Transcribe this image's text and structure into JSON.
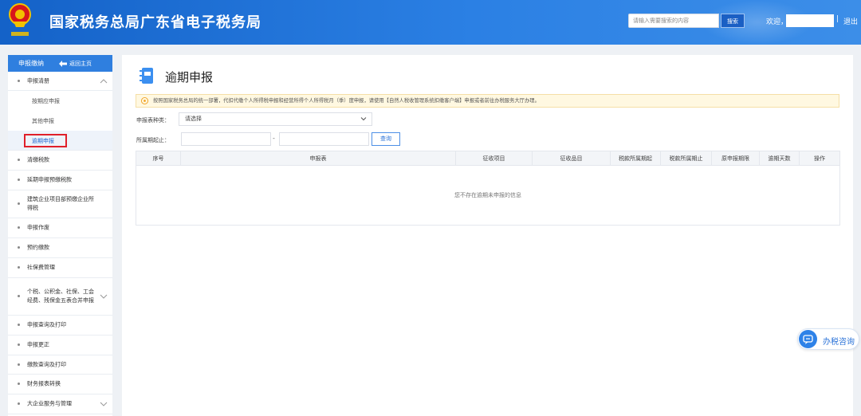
{
  "header": {
    "site_title": "国家税务总局广东省电子税务局",
    "search_placeholder": "请输入需要搜索的内容",
    "search_button": "搜索",
    "welcome": "欢迎，",
    "separator": "|",
    "logout": "退出",
    "colors": {
      "bar": "#1f6fd6"
    }
  },
  "sidebar": {
    "title": "申报缴纳",
    "home_link": "返回主页",
    "items": [
      {
        "label": "申报清册",
        "expanded": true,
        "sub": [
          {
            "label": "按期应申报"
          },
          {
            "label": "其他申报"
          },
          {
            "label": "逾期申报",
            "active": true
          }
        ]
      },
      {
        "label": "清缴税款"
      },
      {
        "label": "延期申报预缴税款"
      },
      {
        "label": "建筑企业项目部预缴企业所得税"
      },
      {
        "label": "申报作废"
      },
      {
        "label": "预约缴款"
      },
      {
        "label": "社保费管理"
      },
      {
        "label": "个税、公积金、社保、工会经费、残保金五表合并申报"
      },
      {
        "label": "申报查询及打印"
      },
      {
        "label": "申报更正"
      },
      {
        "label": "缴款查询及打印"
      },
      {
        "label": "财务报表转换"
      },
      {
        "label": "大企业服务与管理"
      }
    ]
  },
  "main": {
    "title": "逾期申报",
    "notice": "按照国家税务总局的统一部署，代扣代缴个人所得税申报和经营所得个人所得税月（季）度申报，请使用【自然人税收管理系统扣缴客户端】申报或者前往办税服务大厅办理。",
    "form": {
      "type_label": "申报表种类：",
      "type_value": "请选择",
      "period_label": "所属期起止：",
      "dash": "-",
      "query_button": "查询"
    },
    "table": {
      "headers": [
        "序号",
        "申报表",
        "征收项目",
        "征收品目",
        "税款所属期起",
        "税款所属期止",
        "原申报期限",
        "逾期天数",
        "操作"
      ],
      "empty_text": "您不存在逾期未申报的信息"
    }
  },
  "consult": {
    "label": "办税咨询"
  }
}
